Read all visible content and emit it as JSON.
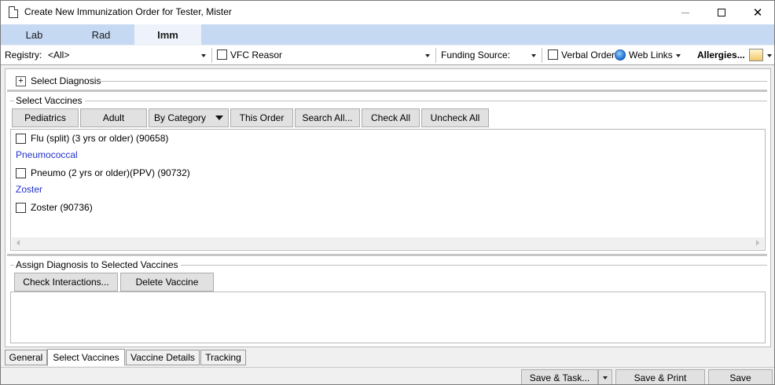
{
  "window": {
    "title": "Create New Immunization Order for Tester, Mister",
    "minimize_glyph": "—",
    "maximize_glyph": "□",
    "close_glyph": "✕"
  },
  "module_tabs": [
    {
      "label": "Lab",
      "active": false
    },
    {
      "label": "Rad",
      "active": false
    },
    {
      "label": "Imm",
      "active": true
    }
  ],
  "toolbar": {
    "registry_label": "Registry:",
    "registry_value": "<All>",
    "vfc_reason_label": "VFC Reason",
    "funding_source_label": "Funding Source:",
    "verbal_order_label": "Verbal Order",
    "web_links_label": "Web Links",
    "allergies_label": "Allergies..."
  },
  "diagnosis": {
    "expander": "+",
    "label": "Select Diagnosis"
  },
  "select_vaccines": {
    "group_label": "Select Vaccines",
    "buttons": {
      "pediatrics": "Pediatrics",
      "adult": "Adult",
      "by_category": "By Category",
      "this_order": "This Order",
      "search_all": "Search All...",
      "check_all": "Check All",
      "uncheck_all": "Uncheck All"
    },
    "items": [
      {
        "kind": "vaccine",
        "label": "Flu (split) (3 yrs or older) (90658)",
        "checked": false
      },
      {
        "kind": "category",
        "label": "Pneumococcal"
      },
      {
        "kind": "vaccine",
        "label": "Pneumo (2 yrs or older)(PPV) (90732)",
        "checked": false
      },
      {
        "kind": "category",
        "label": "Zoster"
      },
      {
        "kind": "vaccine",
        "label": "Zoster (90736)",
        "checked": false
      }
    ]
  },
  "assign_diagnosis": {
    "group_label": "Assign Diagnosis to Selected Vaccines",
    "check_interactions": "Check Interactions...",
    "delete_vaccine": "Delete Vaccine"
  },
  "bottom_tabs": [
    {
      "label": "General",
      "active": false
    },
    {
      "label": "Select Vaccines",
      "active": true
    },
    {
      "label": "Vaccine Details",
      "active": false
    },
    {
      "label": "Tracking",
      "active": false
    }
  ],
  "footer": {
    "save_task": "Save & Task...",
    "save_print": "Save & Print",
    "save": "Save"
  },
  "colors": {
    "module_tab_bar": "#c6d9f3",
    "category_text": "#2233cc"
  }
}
